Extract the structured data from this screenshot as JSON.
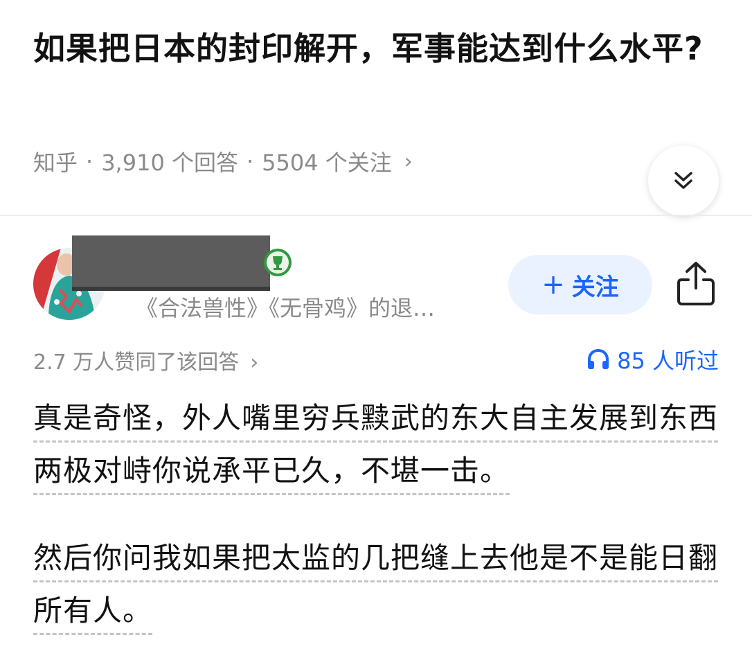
{
  "question": {
    "title": "如果把日本的封印解开，军事能达到什么水平?",
    "source": "知乎",
    "answers": "3,910 个回答",
    "followers": "5504 个关注"
  },
  "author": {
    "signature": "《合法兽性》《无骨鸡》的退…",
    "follow_label": "关注"
  },
  "stats": {
    "upvotes": "2.7 万人赞同了该回答",
    "listens": "85 人听过"
  },
  "content": {
    "paragraph_1": "真是奇怪，外人嘴里穷兵黩武的东大自主发展到东西两极对峙你说承平已久，不堪一击。",
    "paragraph_2": "然后你问我如果把太监的几把缝上去他是不是能日翻所有人。"
  },
  "colors": {
    "accent": "#1a66ff",
    "muted": "#8a8a8a",
    "follow_bg": "#ebf2ff"
  },
  "icons": {
    "expand": "double-chevron-down-icon",
    "share": "share-icon",
    "listen": "headphones-icon",
    "badge": "trophy-badge-icon"
  }
}
